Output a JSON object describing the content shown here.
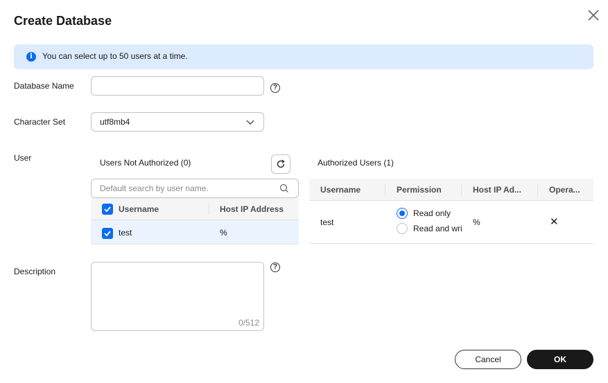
{
  "dialog": {
    "title": "Create Database",
    "info_text": "You can select up to 50 users at a time."
  },
  "form": {
    "database_name_label": "Database Name",
    "database_name_value": "",
    "help_glyph": "?",
    "character_set_label": "Character Set",
    "character_set_value": "utf8mb4",
    "user_label": "User",
    "description_label": "Description",
    "description_value": "",
    "description_counter": "0/512"
  },
  "unauthorized": {
    "title": "Users Not Authorized (0)",
    "search_placeholder": "Default search by user name.",
    "columns": [
      "Username",
      "Host IP Address"
    ],
    "rows": [
      {
        "username": "test",
        "host": "%",
        "checked": true
      }
    ]
  },
  "authorized": {
    "title": "Authorized Users (1)",
    "columns": [
      "Username",
      "Permission",
      "Host IP Ad...",
      "Opera..."
    ],
    "rows": [
      {
        "username": "test",
        "permission_options": [
          "Read only",
          "Read and wri"
        ],
        "selected_permission": "Read only",
        "host": "%",
        "remove_glyph": "✕"
      }
    ]
  },
  "footer": {
    "cancel_label": "Cancel",
    "ok_label": "OK"
  },
  "colors": {
    "accent": "#0a6cf0",
    "banner_bg": "#dcebfd",
    "primary_button": "#191919"
  },
  "icons": [
    "close-icon",
    "info-icon",
    "help-icon",
    "chevron-down-icon",
    "refresh-icon",
    "search-icon",
    "check-icon",
    "remove-icon"
  ]
}
